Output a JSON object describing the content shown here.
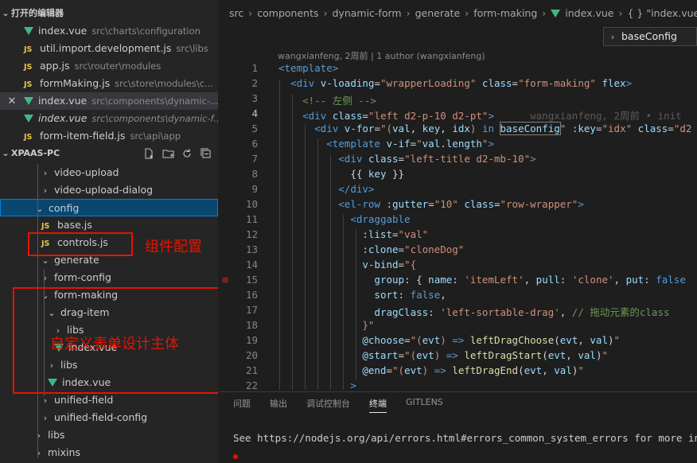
{
  "sidebar": {
    "open_editors_title": "打开的编辑器",
    "open_editors": [
      {
        "type": "vue",
        "name": "index.vue",
        "path": "src\\charts\\configuration"
      },
      {
        "type": "js",
        "name": "util.import.development.js",
        "path": "src\\libs"
      },
      {
        "type": "js",
        "name": "app.js",
        "path": "src\\router\\modules"
      },
      {
        "type": "js",
        "name": "formMaking.js",
        "path": "src\\store\\modules\\c..."
      },
      {
        "type": "vue",
        "name": "index.vue",
        "path": "src\\components\\dynamic-..."
      },
      {
        "type": "vue",
        "name": "index.vue",
        "path": "src\\components\\dynamic-f...",
        "italic": true
      },
      {
        "type": "js",
        "name": "form-item-field.js",
        "path": "src\\api\\app"
      }
    ],
    "project_title": "XPAAS-PC",
    "tree": [
      {
        "label": "video-upload",
        "type": "folder",
        "chev": "›"
      },
      {
        "label": "video-upload-dialog",
        "type": "folder",
        "chev": "›"
      },
      {
        "label": "config",
        "type": "folder",
        "chev": "⌄"
      },
      {
        "label": "base.js",
        "type": "js"
      },
      {
        "label": "controls.js",
        "type": "js"
      },
      {
        "label": "generate",
        "type": "folder",
        "chev": "⌄"
      },
      {
        "label": "form-config",
        "type": "folder",
        "chev": "›"
      },
      {
        "label": "form-making",
        "type": "folder",
        "chev": "⌄"
      },
      {
        "label": "drag-item",
        "type": "folder",
        "chev": "⌄"
      },
      {
        "label": "libs",
        "type": "folder",
        "chev": "›"
      },
      {
        "label": "index.vue",
        "type": "vue"
      },
      {
        "label": "libs",
        "type": "folder",
        "chev": "›"
      },
      {
        "label": "index.vue",
        "type": "vue"
      },
      {
        "label": "unified-field",
        "type": "folder",
        "chev": "›"
      },
      {
        "label": "unified-field-config",
        "type": "folder",
        "chev": "›"
      },
      {
        "label": "libs",
        "type": "folder",
        "chev": "›"
      },
      {
        "label": "mixins",
        "type": "folder",
        "chev": "›"
      }
    ],
    "annotations": {
      "config_note": "组件配置",
      "design_note": "自定义表单设计主体"
    },
    "icons": [
      "new-file-icon",
      "new-folder-icon",
      "refresh-icon",
      "collapse-all-icon"
    ]
  },
  "breadcrumb": {
    "items": [
      "src",
      "components",
      "dynamic-form",
      "generate",
      "form-making",
      "index.vue",
      "{ } \"index.vue\""
    ],
    "dropdown_item": "baseConfig"
  },
  "blame_header": "wangxianfeng, 2周前 | 1 author (wangxianfeng)",
  "editor": {
    "lines": [
      {
        "n": "1",
        "tokens": [
          [
            "t-tag",
            "<template>"
          ]
        ]
      },
      {
        "n": "2",
        "tokens": [
          [
            "t-plain",
            "  "
          ],
          [
            "t-tag",
            "<div "
          ],
          [
            "t-attr",
            "v-loading"
          ],
          [
            "t-plain",
            "="
          ],
          [
            "t-str",
            "\"wrapperLoading\""
          ],
          [
            "t-attr",
            " class"
          ],
          [
            "t-plain",
            "="
          ],
          [
            "t-str",
            "\"form-making\""
          ],
          [
            "t-attr",
            " flex"
          ],
          [
            "t-tag",
            ">"
          ]
        ]
      },
      {
        "n": "3",
        "tokens": [
          [
            "t-plain",
            "    "
          ],
          [
            "t-com",
            "<!-- 左侧 -->"
          ]
        ]
      },
      {
        "n": "4",
        "cur": true,
        "tokens": [
          [
            "t-plain",
            "    "
          ],
          [
            "t-tag",
            "<div "
          ],
          [
            "t-attr",
            "class"
          ],
          [
            "t-plain",
            "="
          ],
          [
            "t-str",
            "\"left d2-p-10 d2-pt\""
          ],
          [
            "t-tag",
            ">"
          ],
          [
            "t-blame",
            "      wangxianfeng, 2周前 • init"
          ]
        ]
      },
      {
        "n": "5",
        "tokens": [
          [
            "t-plain",
            "      "
          ],
          [
            "t-tag",
            "<div "
          ],
          [
            "t-attr",
            "v-for"
          ],
          [
            "t-plain",
            "="
          ],
          [
            "t-str",
            "\"("
          ],
          [
            "t-var",
            "val"
          ],
          [
            "t-plain",
            ", "
          ],
          [
            "t-var",
            "key"
          ],
          [
            "t-plain",
            ", "
          ],
          [
            "t-var",
            "idx"
          ],
          [
            "t-str",
            ") "
          ],
          [
            "t-kw",
            "in "
          ],
          [
            "t-var",
            "baseConfig"
          ],
          [
            "t-str",
            "\""
          ],
          [
            "t-attr",
            " :key"
          ],
          [
            "t-plain",
            "="
          ],
          [
            "t-str",
            "\"idx\""
          ],
          [
            "t-attr",
            " class"
          ],
          [
            "t-plain",
            "="
          ],
          [
            "t-str",
            "\"d2"
          ]
        ]
      },
      {
        "n": "6",
        "tokens": [
          [
            "t-plain",
            "        "
          ],
          [
            "t-tag",
            "<template "
          ],
          [
            "t-attr",
            "v-if"
          ],
          [
            "t-plain",
            "="
          ],
          [
            "t-str",
            "\""
          ],
          [
            "t-var",
            "val"
          ],
          [
            "t-plain",
            "."
          ],
          [
            "t-var",
            "length"
          ],
          [
            "t-str",
            "\""
          ],
          [
            "t-tag",
            ">"
          ]
        ]
      },
      {
        "n": "7",
        "tokens": [
          [
            "t-plain",
            "          "
          ],
          [
            "t-tag",
            "<div "
          ],
          [
            "t-attr",
            "class"
          ],
          [
            "t-plain",
            "="
          ],
          [
            "t-str",
            "\"left-title d2-mb-10\""
          ],
          [
            "t-tag",
            ">"
          ]
        ]
      },
      {
        "n": "8",
        "tokens": [
          [
            "t-plain",
            "            "
          ],
          [
            "t-plain",
            "{{ "
          ],
          [
            "t-var",
            "key"
          ],
          [
            "t-plain",
            " }}"
          ]
        ]
      },
      {
        "n": "9",
        "tokens": [
          [
            "t-plain",
            "          "
          ],
          [
            "t-tag",
            "</div>"
          ]
        ]
      },
      {
        "n": "10",
        "tokens": [
          [
            "t-plain",
            "          "
          ],
          [
            "t-tag",
            "<el-row "
          ],
          [
            "t-attr",
            ":gutter"
          ],
          [
            "t-plain",
            "="
          ],
          [
            "t-str",
            "\"10\""
          ],
          [
            "t-attr",
            " class"
          ],
          [
            "t-plain",
            "="
          ],
          [
            "t-str",
            "\"row-wrapper\""
          ],
          [
            "t-tag",
            ">"
          ]
        ]
      },
      {
        "n": "11",
        "tokens": [
          [
            "t-plain",
            "            "
          ],
          [
            "t-tag",
            "<draggable"
          ]
        ]
      },
      {
        "n": "12",
        "tokens": [
          [
            "t-plain",
            "              "
          ],
          [
            "t-attr",
            ":list"
          ],
          [
            "t-plain",
            "="
          ],
          [
            "t-str",
            "\"val\""
          ]
        ]
      },
      {
        "n": "13",
        "tokens": [
          [
            "t-plain",
            "              "
          ],
          [
            "t-attr",
            ":clone"
          ],
          [
            "t-plain",
            "="
          ],
          [
            "t-str",
            "\"cloneDog\""
          ]
        ]
      },
      {
        "n": "14",
        "tokens": [
          [
            "t-plain",
            "              "
          ],
          [
            "t-attr",
            "v-bind"
          ],
          [
            "t-plain",
            "="
          ],
          [
            "t-str",
            "\"{"
          ]
        ]
      },
      {
        "n": "15",
        "tokens": [
          [
            "t-plain",
            "                "
          ],
          [
            "t-var",
            "group"
          ],
          [
            "t-plain",
            ": { "
          ],
          [
            "t-var",
            "name"
          ],
          [
            "t-plain",
            ": "
          ],
          [
            "t-str",
            "'itemLeft'"
          ],
          [
            "t-plain",
            ", "
          ],
          [
            "t-var",
            "pull"
          ],
          [
            "t-plain",
            ": "
          ],
          [
            "t-str",
            "'clone'"
          ],
          [
            "t-plain",
            ", "
          ],
          [
            "t-var",
            "put"
          ],
          [
            "t-plain",
            ": "
          ],
          [
            "t-kw",
            "false"
          ]
        ]
      },
      {
        "n": "16",
        "tokens": [
          [
            "t-plain",
            "                "
          ],
          [
            "t-var",
            "sort"
          ],
          [
            "t-plain",
            ": "
          ],
          [
            "t-kw",
            "false"
          ],
          [
            "t-plain",
            ","
          ]
        ]
      },
      {
        "n": "17",
        "tokens": [
          [
            "t-plain",
            "                "
          ],
          [
            "t-var",
            "dragClass"
          ],
          [
            "t-plain",
            ": "
          ],
          [
            "t-str",
            "'left-sortable-drag'"
          ],
          [
            "t-plain",
            ", "
          ],
          [
            "t-com",
            "// 拖动元素的class"
          ]
        ]
      },
      {
        "n": "18",
        "tokens": [
          [
            "t-plain",
            "              "
          ],
          [
            "t-str",
            "}\""
          ]
        ]
      },
      {
        "n": "19",
        "tokens": [
          [
            "t-plain",
            "              "
          ],
          [
            "t-attr",
            "@choose"
          ],
          [
            "t-plain",
            "="
          ],
          [
            "t-str",
            "\"("
          ],
          [
            "t-var",
            "evt"
          ],
          [
            "t-str",
            ") "
          ],
          [
            "t-kw",
            "=>"
          ],
          [
            "t-plain",
            " "
          ],
          [
            "t-func",
            "leftDragChoose"
          ],
          [
            "t-plain",
            "("
          ],
          [
            "t-var",
            "evt"
          ],
          [
            "t-plain",
            ", "
          ],
          [
            "t-var",
            "val"
          ],
          [
            "t-plain",
            ")"
          ],
          [
            "t-str",
            "\""
          ]
        ]
      },
      {
        "n": "20",
        "tokens": [
          [
            "t-plain",
            "              "
          ],
          [
            "t-attr",
            "@start"
          ],
          [
            "t-plain",
            "="
          ],
          [
            "t-str",
            "\"("
          ],
          [
            "t-var",
            "evt"
          ],
          [
            "t-str",
            ") "
          ],
          [
            "t-kw",
            "=>"
          ],
          [
            "t-plain",
            " "
          ],
          [
            "t-func",
            "leftDragStart"
          ],
          [
            "t-plain",
            "("
          ],
          [
            "t-var",
            "evt"
          ],
          [
            "t-plain",
            ", "
          ],
          [
            "t-var",
            "val"
          ],
          [
            "t-plain",
            ")"
          ],
          [
            "t-str",
            "\""
          ]
        ]
      },
      {
        "n": "21",
        "tokens": [
          [
            "t-plain",
            "              "
          ],
          [
            "t-attr",
            "@end"
          ],
          [
            "t-plain",
            "="
          ],
          [
            "t-str",
            "\"("
          ],
          [
            "t-var",
            "evt"
          ],
          [
            "t-str",
            ") "
          ],
          [
            "t-kw",
            "=>"
          ],
          [
            "t-plain",
            " "
          ],
          [
            "t-func",
            "leftDragEnd"
          ],
          [
            "t-plain",
            "("
          ],
          [
            "t-var",
            "evt"
          ],
          [
            "t-plain",
            ", "
          ],
          [
            "t-var",
            "val"
          ],
          [
            "t-plain",
            ")"
          ],
          [
            "t-str",
            "\""
          ]
        ]
      },
      {
        "n": "22",
        "tokens": [
          [
            "t-plain",
            "            "
          ],
          [
            "t-tag",
            ">"
          ]
        ]
      }
    ]
  },
  "panel": {
    "tabs": [
      "问题",
      "输出",
      "调试控制台",
      "终端",
      "GITLENS"
    ],
    "active_tab": "终端",
    "terminal_line": "See https://nodejs.org/api/errors.html#errors_common_system_errors for more information"
  },
  "colors": {
    "annotation_red": "#e51400",
    "selection_blue": "#094771",
    "vue_green": "#41b883",
    "js_yellow": "#e8c547"
  }
}
